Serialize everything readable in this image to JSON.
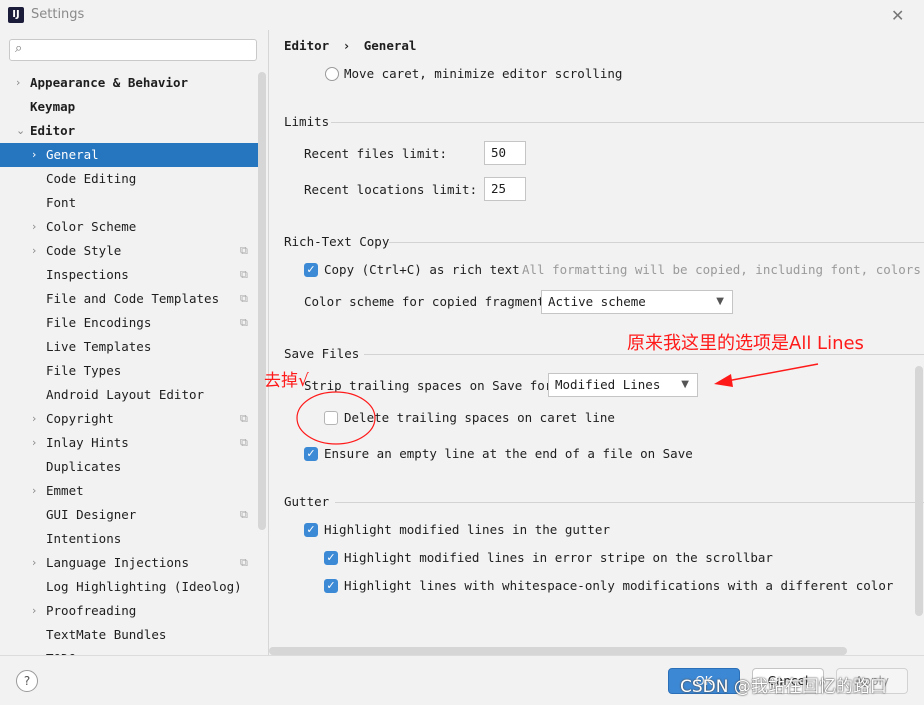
{
  "window": {
    "title": "Settings",
    "app_icon_text": "IJ"
  },
  "sidebar": {
    "search_placeholder": "",
    "items": [
      {
        "label": "Appearance & Behavior",
        "chev": "›",
        "bold": true
      },
      {
        "label": "Keymap",
        "chev": "",
        "bold": true
      },
      {
        "label": "Editor",
        "chev": "⌄",
        "bold": true
      },
      {
        "label": "General",
        "chev": "›",
        "selected": true
      },
      {
        "label": "Code Editing",
        "chev": ""
      },
      {
        "label": "Font",
        "chev": ""
      },
      {
        "label": "Color Scheme",
        "chev": "›"
      },
      {
        "label": "Code Style",
        "chev": "›",
        "proj": true
      },
      {
        "label": "Inspections",
        "chev": "",
        "proj": true
      },
      {
        "label": "File and Code Templates",
        "chev": "",
        "proj": true
      },
      {
        "label": "File Encodings",
        "chev": "",
        "proj": true
      },
      {
        "label": "Live Templates",
        "chev": ""
      },
      {
        "label": "File Types",
        "chev": ""
      },
      {
        "label": "Android Layout Editor",
        "chev": ""
      },
      {
        "label": "Copyright",
        "chev": "›",
        "proj": true
      },
      {
        "label": "Inlay Hints",
        "chev": "›",
        "proj": true
      },
      {
        "label": "Duplicates",
        "chev": ""
      },
      {
        "label": "Emmet",
        "chev": "›"
      },
      {
        "label": "GUI Designer",
        "chev": "",
        "proj": true
      },
      {
        "label": "Intentions",
        "chev": ""
      },
      {
        "label": "Language Injections",
        "chev": "›",
        "proj": true
      },
      {
        "label": "Log Highlighting (Ideolog)",
        "chev": ""
      },
      {
        "label": "Proofreading",
        "chev": "›"
      },
      {
        "label": "TextMate Bundles",
        "chev": ""
      },
      {
        "label": "TODO",
        "chev": ""
      }
    ]
  },
  "breadcrumb": {
    "parent": "Editor",
    "sep": "›",
    "current": "General"
  },
  "caret": {
    "radio_label": "Move caret, minimize editor scrolling"
  },
  "limits": {
    "title": "Limits",
    "recent_files_label": "Recent files limit:",
    "recent_files_value": "50",
    "recent_locations_label": "Recent locations limit:",
    "recent_locations_value": "25"
  },
  "rich_text": {
    "title": "Rich-Text Copy",
    "copy_label": "Copy (Ctrl+C) as rich text",
    "copy_hint": "All formatting will be copied, including font, colors and",
    "copy_checked": true,
    "scheme_label": "Color scheme for copied fragment:",
    "scheme_value": "Active scheme"
  },
  "save_files": {
    "title": "Save Files",
    "strip_label": "Strip trailing spaces on Save for:",
    "strip_value": "Modified Lines",
    "delete_caret_label": "Delete trailing spaces on caret line",
    "delete_caret_checked": false,
    "ensure_label": "Ensure an empty line at the end of a file on Save",
    "ensure_checked": true
  },
  "gutter": {
    "title": "Gutter",
    "highlight_modified": "Highlight modified lines in the gutter",
    "highlight_error_stripe": "Highlight modified lines in error stripe on the scrollbar",
    "highlight_whitespace": "Highlight lines with whitespace-only modifications with a different color"
  },
  "buttons": {
    "help": "?",
    "ok": "OK",
    "cancel": "Cancel",
    "apply": "Apply"
  },
  "annotations": {
    "note_right": "原来我这里的选项是All Lines",
    "note_left": "去掉√",
    "color": "#ff1a1a"
  },
  "watermark": "CSDN @我站在回忆的路口"
}
